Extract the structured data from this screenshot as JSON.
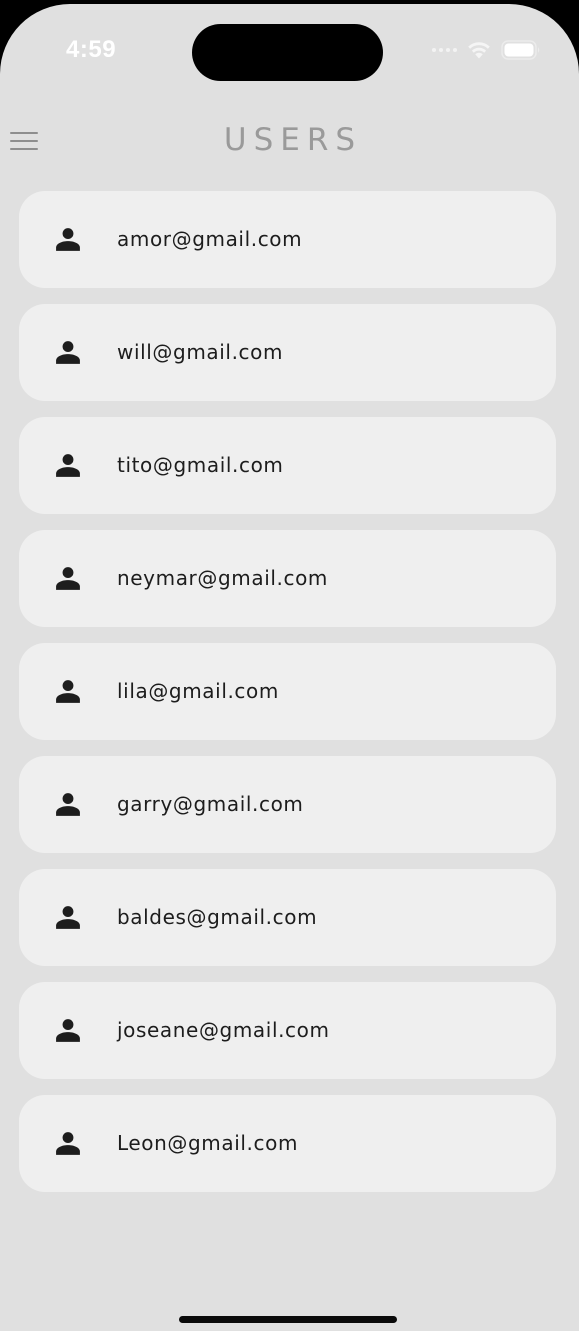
{
  "status_bar": {
    "time": "4:59",
    "signal_icon": "cellular-signal-icon",
    "wifi_icon": "wifi-icon",
    "battery_icon": "battery-icon"
  },
  "header": {
    "menu_icon": "hamburger-menu-icon",
    "title": "USERS"
  },
  "users": [
    {
      "email": "amor@gmail.com",
      "icon": "person-icon"
    },
    {
      "email": "will@gmail.com",
      "icon": "person-icon"
    },
    {
      "email": "tito@gmail.com",
      "icon": "person-icon"
    },
    {
      "email": "neymar@gmail.com",
      "icon": "person-icon"
    },
    {
      "email": "lila@gmail.com",
      "icon": "person-icon"
    },
    {
      "email": "garry@gmail.com",
      "icon": "person-icon"
    },
    {
      "email": "baldes@gmail.com",
      "icon": "person-icon"
    },
    {
      "email": "joseane@gmail.com",
      "icon": "person-icon"
    },
    {
      "email": "Leon@gmail.com",
      "icon": "person-icon"
    }
  ],
  "colors": {
    "background": "#e0e0e0",
    "card": "#efefef",
    "title": "#9a9a9a",
    "text": "#1d1d1d",
    "icon": "#1d1d1d"
  }
}
